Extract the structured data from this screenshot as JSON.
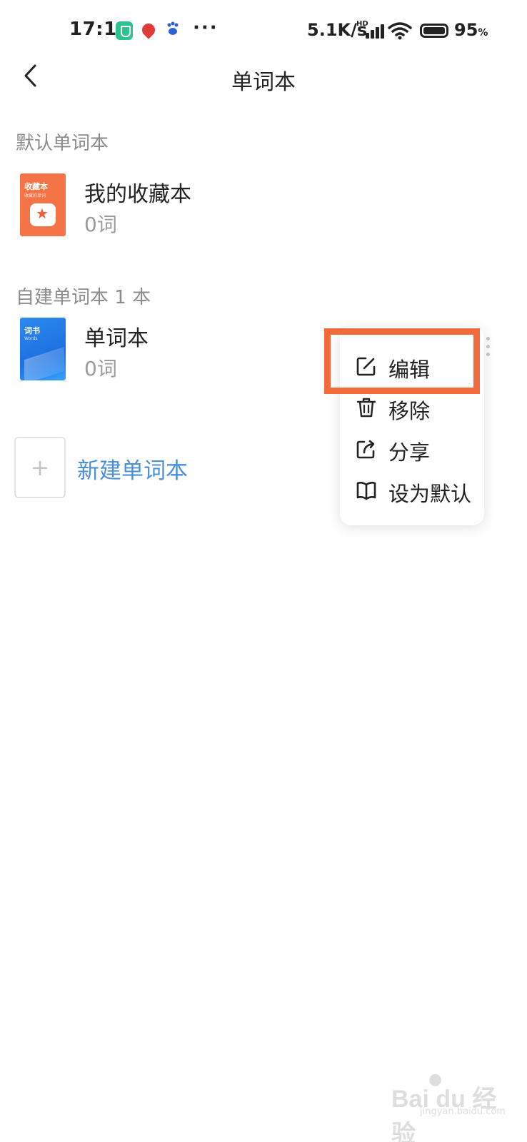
{
  "status_bar": {
    "time": "17:14",
    "more": "···",
    "speed": "5.1K/s",
    "network_badge": "HD",
    "battery_value": "95",
    "battery_unit": "%",
    "icons": [
      "shield-icon",
      "location-pin-icon",
      "baidu-paw-icon",
      "signal-icon",
      "wifi-icon",
      "battery-icon"
    ]
  },
  "header": {
    "title": "单词本"
  },
  "default_section": {
    "label": "默认单词本",
    "book": {
      "name": "我的收藏本",
      "count": "0词",
      "cover_title": "收藏本",
      "cover_sub": "收藏的单词"
    }
  },
  "custom_section": {
    "label": "自建单词本 1 本",
    "book": {
      "name": "单词本",
      "count": "0词",
      "cover_title": "词书",
      "cover_sub": "Words"
    }
  },
  "new_book": {
    "label": "新建单词本"
  },
  "menu": {
    "items": [
      {
        "label": "编辑",
        "icon": "edit-icon"
      },
      {
        "label": "移除",
        "icon": "trash-icon"
      },
      {
        "label": "分享",
        "icon": "share-icon"
      },
      {
        "label": "设为默认",
        "icon": "book-open-icon"
      }
    ]
  },
  "colors": {
    "highlight": "#f26a3a",
    "link": "#4a90d9",
    "fav_cover": "#f47347",
    "words_cover": "#2c8bf0"
  },
  "watermark": {
    "brand": "Bai du 经验",
    "site": "jingyan.baidu.com"
  }
}
